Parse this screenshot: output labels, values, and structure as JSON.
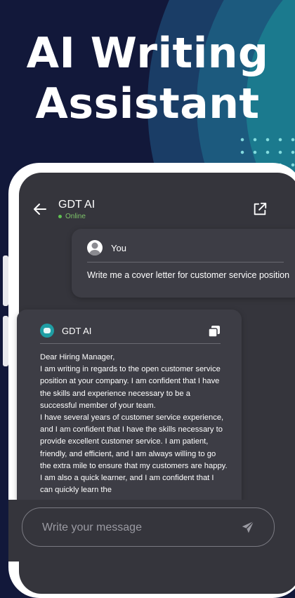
{
  "hero": {
    "line1": "AI Writing",
    "line2": "Assistant"
  },
  "header": {
    "title": "GDT AI",
    "status": "Online",
    "back_icon": "arrow-left-icon",
    "share_icon": "external-link-icon"
  },
  "user_message": {
    "sender": "You",
    "text": "Write me a cover letter for customer service position"
  },
  "ai_message": {
    "sender": "GDT AI",
    "text": "Dear Hiring Manager,\nI am writing in regards to the open customer service position at your company. I am confident that I have the skills and experience necessary to be a successful member of your team.\nI have several years of customer service experience, and I am confident that I have the skills necessary to provide excellent customer service. I am patient, friendly, and efficient, and I am always willing to go the extra mile to ensure that my customers are happy. I am also a quick learner, and I am confident that I can quickly learn the"
  },
  "composer": {
    "placeholder": "Write your message",
    "send_icon": "send-icon"
  },
  "colors": {
    "accent": "#1aa4a6",
    "online": "#5fc251",
    "screen_bg": "#35353c",
    "card_bg": "#3d3d45"
  }
}
